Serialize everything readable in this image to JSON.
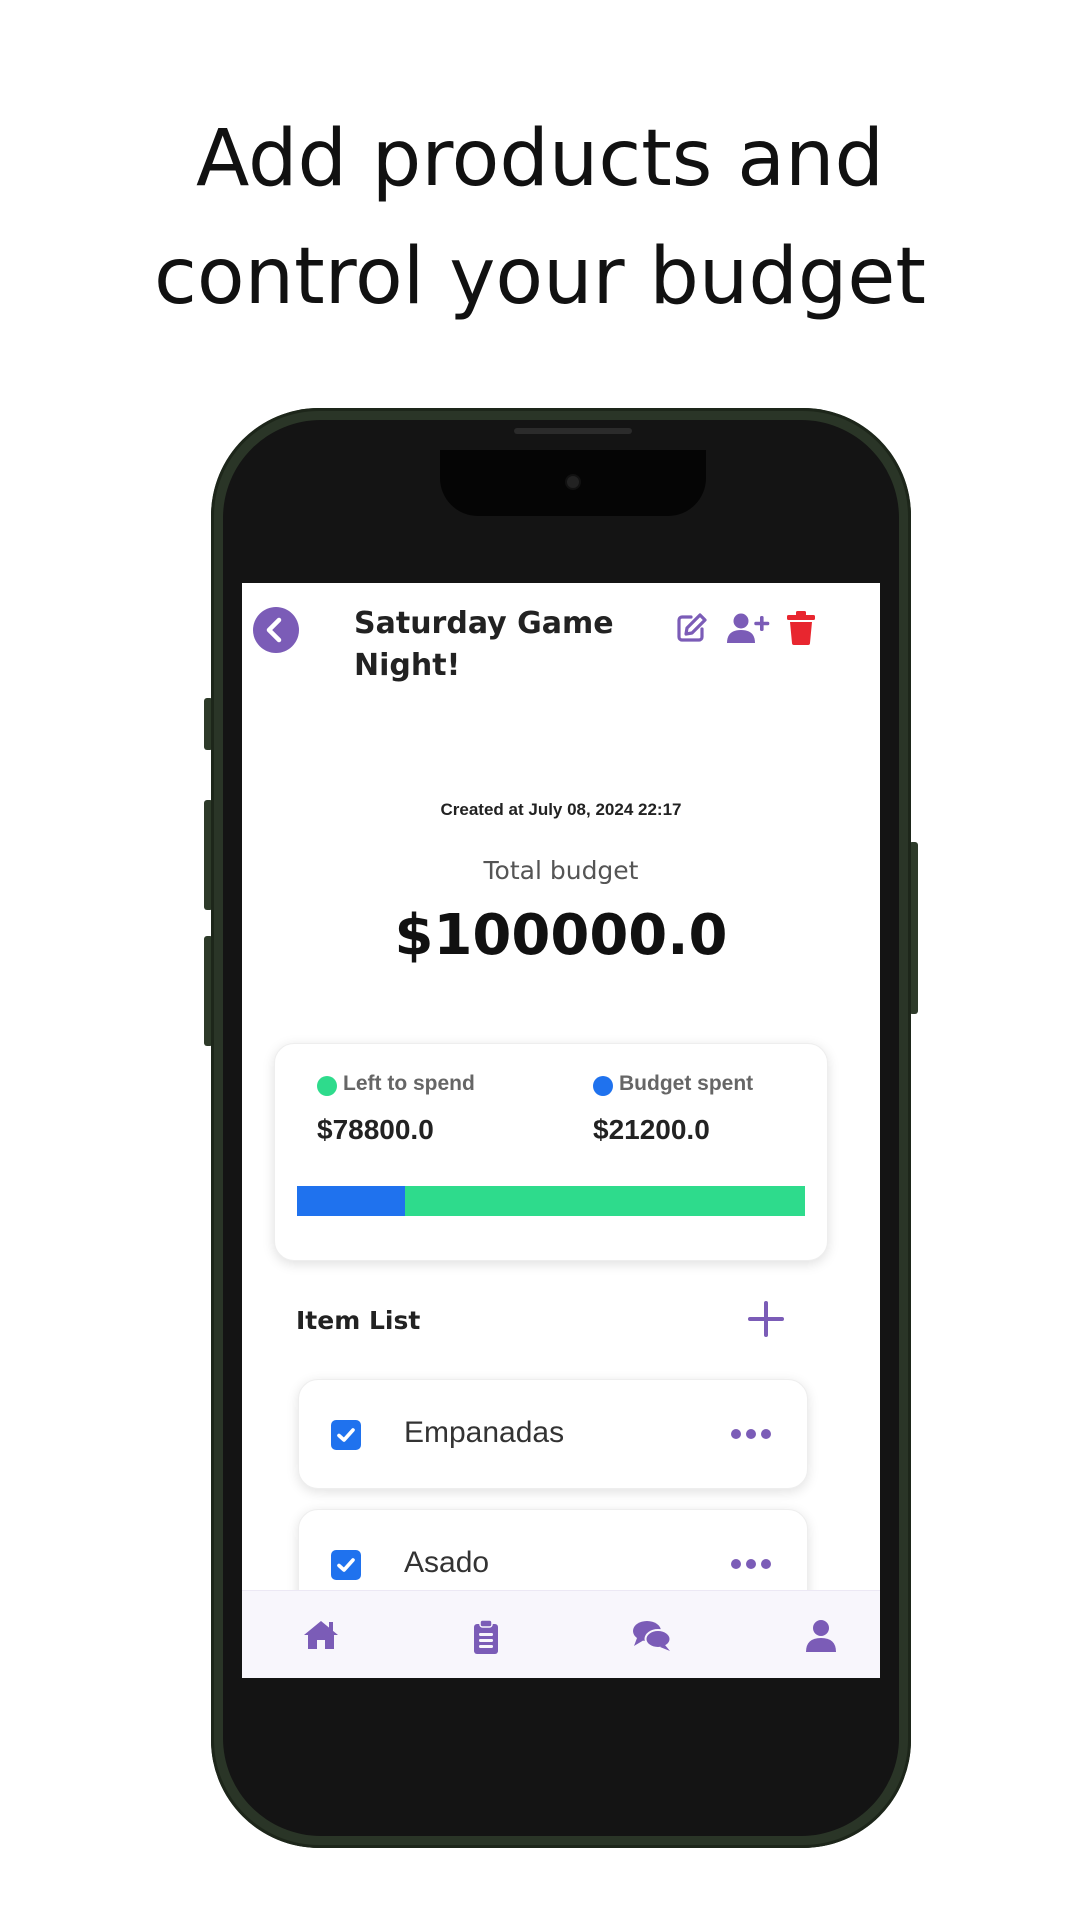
{
  "headline": {
    "line1": "Add products and",
    "line2": "control your budget"
  },
  "screen": {
    "title": "Saturday Game Night!",
    "header_icons": [
      "back-arrow-icon",
      "edit-icon",
      "add-user-icon",
      "trash-icon"
    ],
    "created_at": "Created at July 08, 2024 22:17",
    "total_budget_label": "Total budget",
    "total_budget_value": "$100000.0",
    "summary": {
      "left_to_spend_label": "Left to spend",
      "left_to_spend_value": "$78800.0",
      "budget_spent_label": "Budget spent",
      "budget_spent_value": "$21200.0",
      "spent_fraction": 0.212
    },
    "item_list_title": "Item List",
    "items": [
      {
        "name": "Empanadas",
        "checked": true
      },
      {
        "name": "Asado",
        "checked": true
      }
    ],
    "bottom_nav": [
      "home-icon",
      "clipboard-list-icon",
      "chat-icon",
      "profile-icon"
    ]
  },
  "colors": {
    "accent": "#7b5cb7",
    "danger": "#e8262f",
    "spent": "#1f72ee",
    "left": "#2edb8c"
  }
}
